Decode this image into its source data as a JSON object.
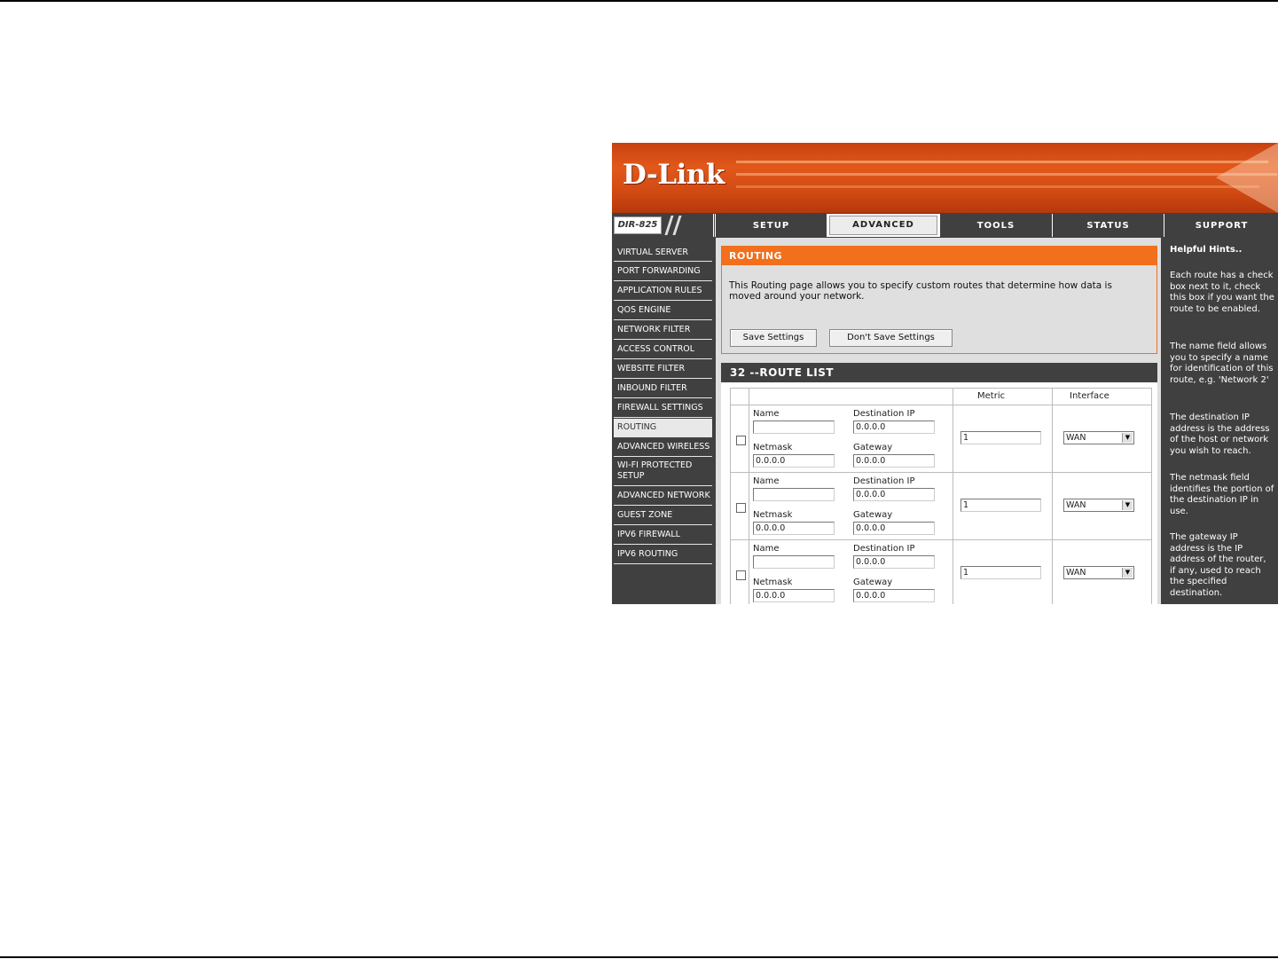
{
  "brand": {
    "logo_text": "D-Link",
    "model": "DIR-825"
  },
  "nav": {
    "tabs": [
      {
        "label": "SETUP"
      },
      {
        "label": "ADVANCED",
        "active": true
      },
      {
        "label": "TOOLS"
      },
      {
        "label": "STATUS"
      },
      {
        "label": "SUPPORT"
      }
    ]
  },
  "menu": {
    "items": [
      "VIRTUAL SERVER",
      "PORT FORWARDING",
      "APPLICATION RULES",
      "QOS ENGINE",
      "NETWORK FILTER",
      "ACCESS CONTROL",
      "WEBSITE FILTER",
      "INBOUND FILTER",
      "FIREWALL SETTINGS",
      "ROUTING",
      "ADVANCED WIRELESS",
      "WI-FI PROTECTED SETUP",
      "ADVANCED NETWORK",
      "GUEST ZONE",
      "IPV6 FIREWALL",
      "IPV6 ROUTING"
    ],
    "active": "ROUTING"
  },
  "routing": {
    "title": "ROUTING",
    "description": "This Routing page allows you to specify custom routes that determine how data is moved around your network.",
    "save_label": "Save Settings",
    "dont_save_label": "Don't Save Settings"
  },
  "route_list": {
    "title": "32 --ROUTE LIST",
    "col_metric": "Metric",
    "col_interface": "Interface",
    "labels": {
      "name": "Name",
      "destination_ip": "Destination IP",
      "netmask": "Netmask",
      "gateway": "Gateway"
    },
    "rows": [
      {
        "name": "",
        "destination_ip": "0.0.0.0",
        "netmask": "0.0.0.0",
        "gateway": "0.0.0.0",
        "metric": "1",
        "interface": "WAN"
      },
      {
        "name": "",
        "destination_ip": "0.0.0.0",
        "netmask": "0.0.0.0",
        "gateway": "0.0.0.0",
        "metric": "1",
        "interface": "WAN"
      },
      {
        "name": "",
        "destination_ip": "0.0.0.0",
        "netmask": "0.0.0.0",
        "gateway": "0.0.0.0",
        "metric": "1",
        "interface": "WAN"
      }
    ]
  },
  "hints": {
    "title": "Helpful Hints..",
    "items": [
      "Each route has a check box next to it, check this box if you want the route to be enabled.",
      "The name field allows you to specify a name for identification of this route, e.g. 'Network 2'",
      "The destination IP address is the address of the host or network you wish to reach.",
      "The netmask field identifies the portion of the destination IP in use.",
      "The gateway IP address is the IP address of the router, if any, used to reach the specified destination."
    ]
  },
  "colors": {
    "orange": "#f26f1c",
    "dark": "#404040",
    "panel": "#dfdfdf"
  }
}
